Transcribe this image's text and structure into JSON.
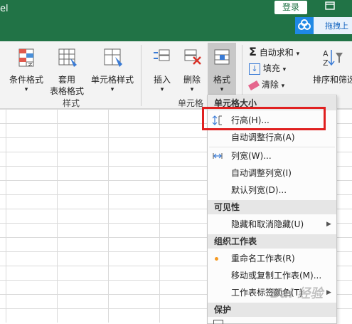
{
  "titlebar": {
    "app_fragment": "el",
    "login": "登录",
    "restore_icon": "restore-icon",
    "cloud_button": "拖拽上"
  },
  "ribbon": {
    "cond_format": "条件格式",
    "table_format_line1": "套用",
    "table_format_line2": "表格格式",
    "cell_style": "单元格样式",
    "style_group": "样式",
    "insert": "插入",
    "delete": "删除",
    "format": "格式",
    "cells_group": "单元格",
    "autosum": "自动求和",
    "fill": "填充",
    "clear": "清除",
    "sort_filter": "排序和筛选",
    "dropdown_mark": "▾"
  },
  "menu": {
    "section_cell_size": "单元格大小",
    "row_height": "行高(H)...",
    "autofit_row": "自动调整行高(A)",
    "col_width": "列宽(W)...",
    "autofit_col": "自动调整列宽(I)",
    "default_width": "默认列宽(D)...",
    "section_visibility": "可见性",
    "hide_unhide": "隐藏和取消隐藏(U)",
    "section_organize": "组织工作表",
    "rename_sheet": "重命名工作表(R)",
    "move_copy": "移动或复制工作表(M)...",
    "tab_color": "工作表标签颜色(T)",
    "section_protect": "保护"
  },
  "colors": {
    "accent": "#217346",
    "highlight": "#e02020",
    "rename_dot": "#f59a23"
  },
  "watermark": "Bai 经验"
}
